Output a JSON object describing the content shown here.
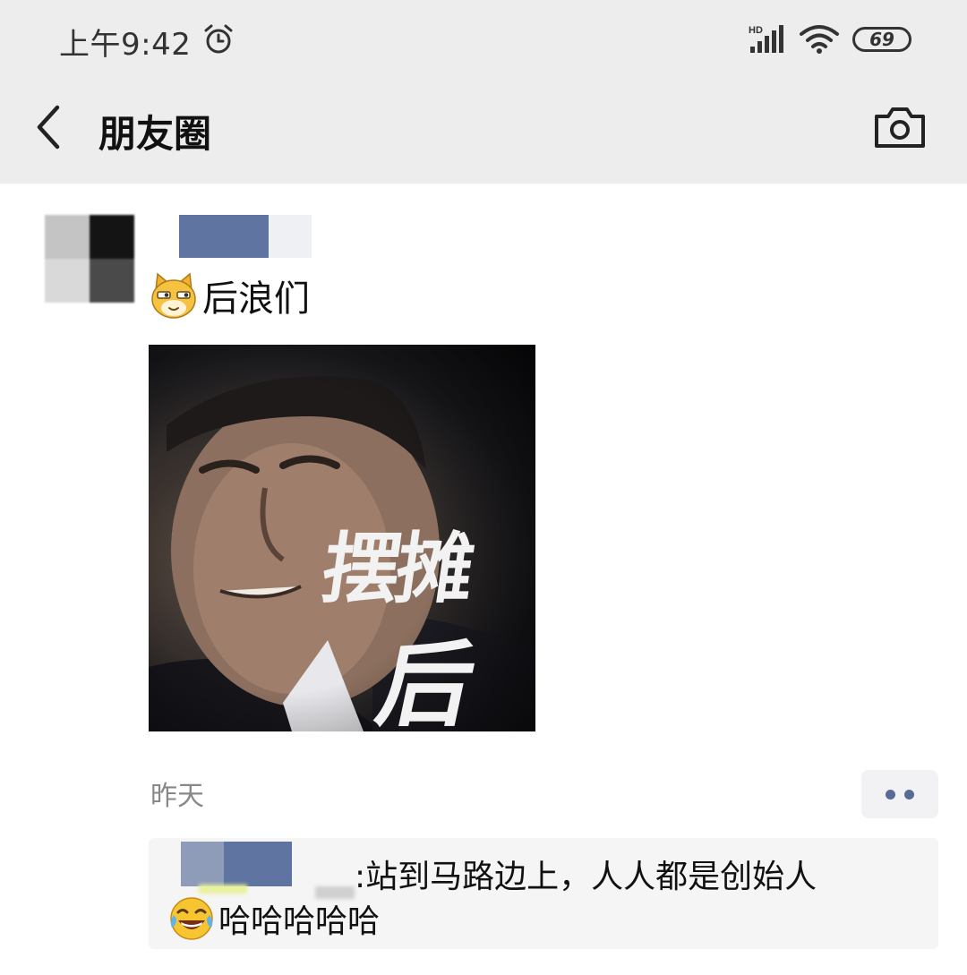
{
  "status_bar": {
    "time": "上午9:42",
    "network_label": "HD",
    "battery_level": "69",
    "icons": [
      "alarm-icon",
      "signal-icon",
      "wifi-icon",
      "battery-icon"
    ]
  },
  "title_bar": {
    "title": "朋友圈",
    "icons": [
      "back-arrow-icon",
      "camera-icon"
    ]
  },
  "post": {
    "text": "后浪们",
    "emoji": "cat-face-emoji",
    "image_overlay_line1": "摆摊",
    "image_overlay_line2": "后",
    "time": "昨天"
  },
  "comment": {
    "text_line1": ":站到马路边上，人人都是创始人",
    "text_line2": "哈哈哈哈哈",
    "emoji": "tears-of-joy-emoji"
  },
  "colors": {
    "header_bg": "#ededed",
    "link_blue": "#576b95",
    "comment_bg": "#f5f5f5",
    "time_gray": "#888888"
  }
}
